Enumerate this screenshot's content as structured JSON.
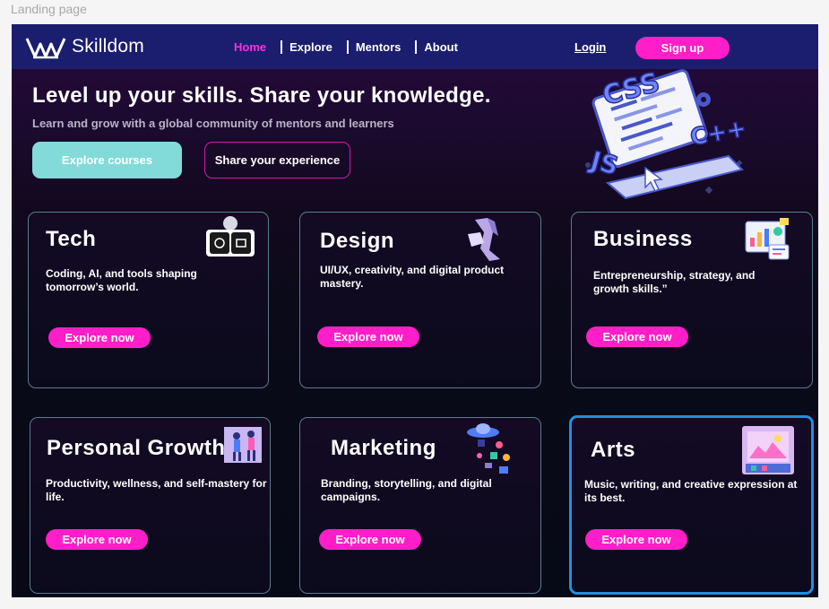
{
  "frame_label": "Landing page",
  "nav": {
    "brand": "Skilldom",
    "links": [
      "Home",
      "Explore",
      "Mentors",
      "About"
    ],
    "login": "Login",
    "signup": "Sign up"
  },
  "hero": {
    "title": "Level up your skills. Share your knowledge.",
    "subtitle": "Learn and grow with a global community of mentors and learners",
    "primary_button": "Explore courses",
    "secondary_button": "Share your experience",
    "art_labels": [
      "CSS",
      "C++",
      "JS"
    ]
  },
  "cards": [
    {
      "title": "Tech",
      "description": "Coding, AI, and tools shaping tomorrow’s world.",
      "button": "Explore now",
      "icon": "tech-devices-icon"
    },
    {
      "title": "Design",
      "description": "UI/UX, creativity, and digital product mastery.",
      "button": "Explore now",
      "icon": "design-3d-shape-icon"
    },
    {
      "title": "Business",
      "description": "Entrepreneurship, strategy, and growth skills.”",
      "button": "Explore now",
      "icon": "business-charts-icon"
    },
    {
      "title": "Personal Growth",
      "description": "Productivity, wellness, and self-mastery for life.",
      "button": "Explore now",
      "icon": "personal-growth-people-icon"
    },
    {
      "title": "Marketing",
      "description": "Branding, storytelling, and digital campaigns.",
      "button": "Explore now",
      "icon": "marketing-ufo-icon"
    },
    {
      "title": "Arts",
      "description": "Music, writing, and creative expression at its best.",
      "button": "Explore now",
      "icon": "arts-painting-icon"
    }
  ],
  "colors": {
    "nav_bg": "#1b1e6e",
    "accent_pink": "#ff1ec8",
    "active_link": "#ff2ee0",
    "teal_button": "#82dbd8",
    "selection_blue": "#1f8fe6"
  }
}
